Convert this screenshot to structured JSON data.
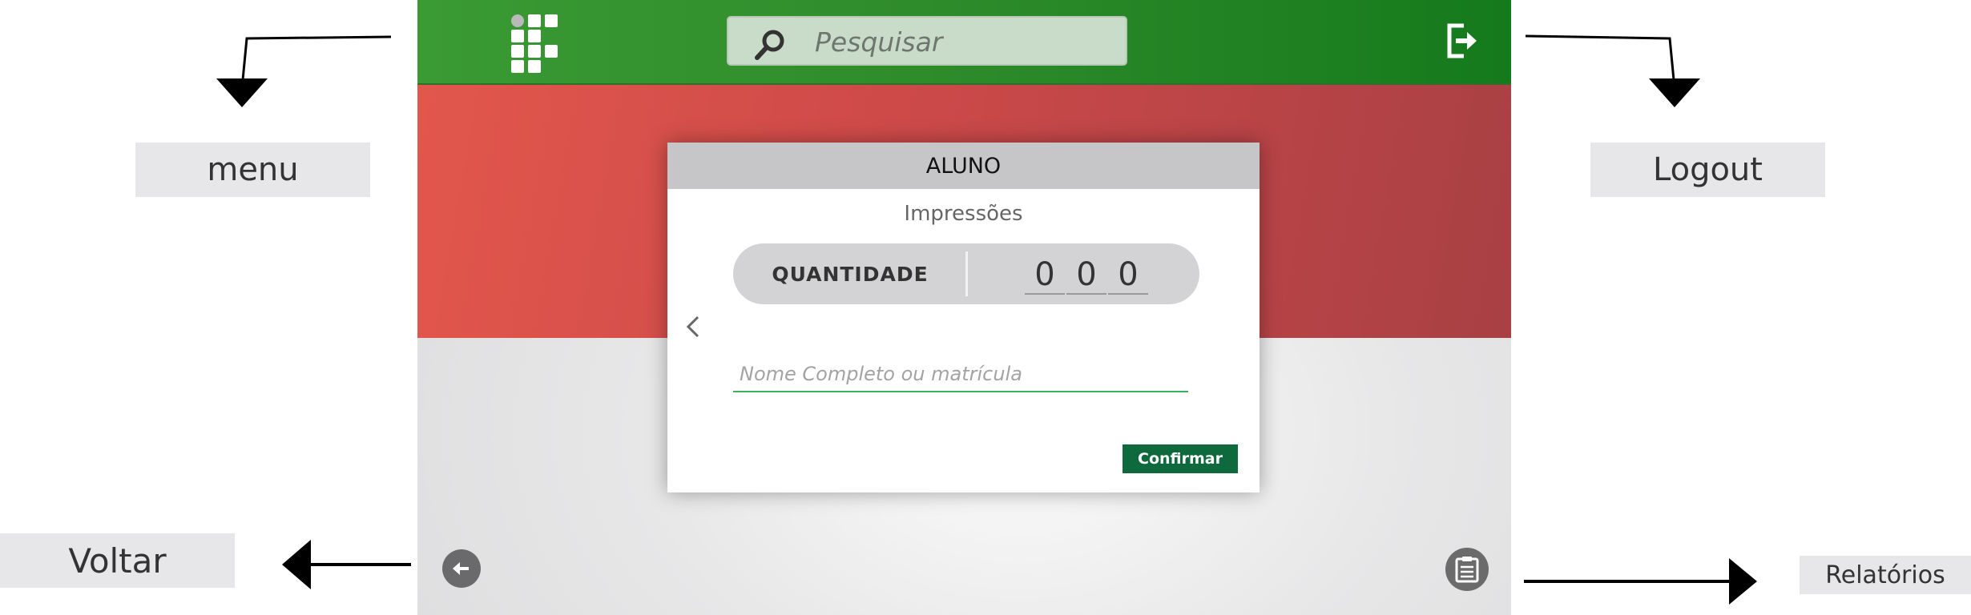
{
  "annotations": {
    "menu": "menu",
    "logout": "Logout",
    "voltar": "Voltar",
    "relatorios": "Relatórios"
  },
  "topbar": {
    "logo_icon": "institutional-logo-icon",
    "search_placeholder": "Pesquisar",
    "search_icon": "search-icon",
    "logout_icon": "logout-icon"
  },
  "modal": {
    "title": "ALUNO",
    "subtitle": "Impressões",
    "quantity_label": "QUANTIDADE",
    "quantity_digits": [
      "0",
      "0",
      "0"
    ],
    "name_placeholder": "Nome Completo ou matrícula",
    "confirm_label": "Confirmar",
    "prev_icon": "chevron-left-icon"
  },
  "footer": {
    "back_icon": "arrow-left-icon",
    "reports_icon": "clipboard-icon"
  },
  "colors": {
    "topbar_green": "#2f8c2b",
    "band_red": "#cc4949",
    "confirm_green": "#0e6a3d",
    "input_underline": "#3db25a"
  }
}
